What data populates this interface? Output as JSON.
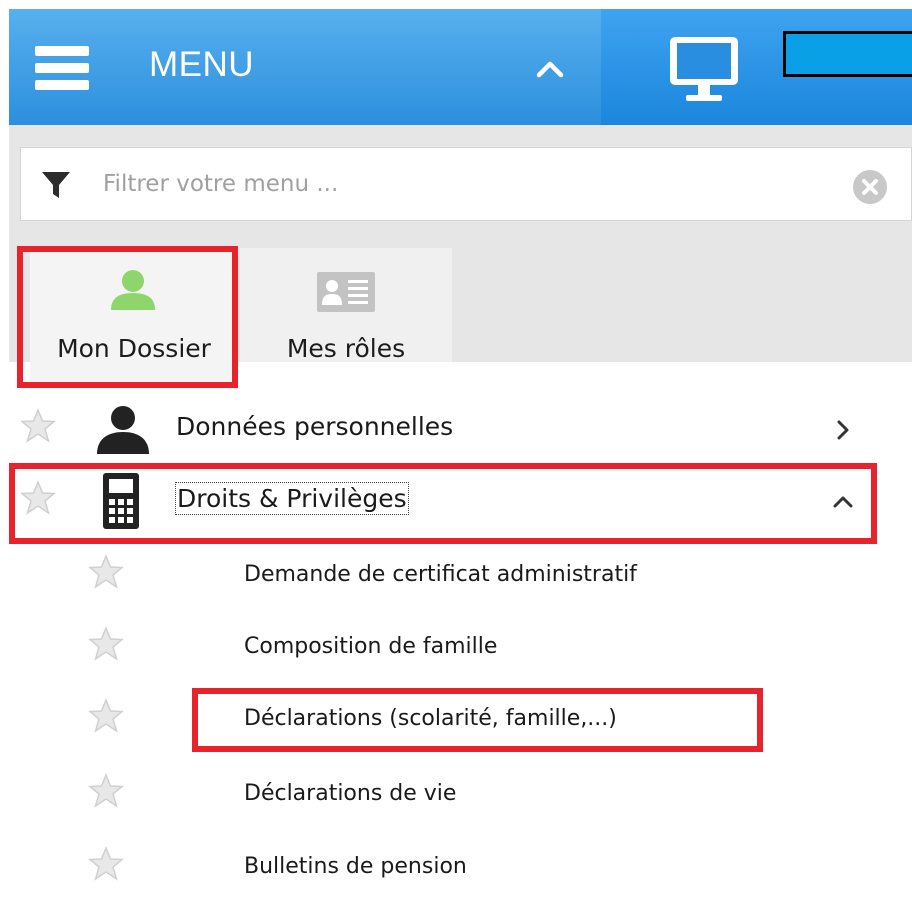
{
  "header": {
    "menu_title": "MENU",
    "icons": [
      "hamburger-icon",
      "chevron-up-icon",
      "monitor-icon"
    ],
    "colors": {
      "header_left": "#3d9fe8",
      "header_right": "#1b86dc",
      "box_fill": "#0aa0e8"
    }
  },
  "filter": {
    "placeholder": "Filtrer votre menu ...",
    "value": ""
  },
  "tabs": [
    {
      "label": "Mon Dossier",
      "icon": "user-icon",
      "active": true,
      "icon_color": "#8ed66b"
    },
    {
      "label": "Mes rôles",
      "icon": "id-card-icon",
      "active": false,
      "icon_color": "#c3c3c3"
    }
  ],
  "menu": {
    "items": [
      {
        "label": "Données personnelles",
        "icon": "person-icon",
        "expanded": false
      },
      {
        "label": "Droits & Privilèges",
        "icon": "calculator-icon",
        "expanded": true
      }
    ],
    "subitems": [
      {
        "label": "Demande de certificat administratif"
      },
      {
        "label": "Composition de famille"
      },
      {
        "label": "Déclarations (scolarité, famille,...)"
      },
      {
        "label": "Déclarations de vie"
      },
      {
        "label": "Bulletins de pension"
      }
    ]
  },
  "highlight_color": "#e8232b"
}
